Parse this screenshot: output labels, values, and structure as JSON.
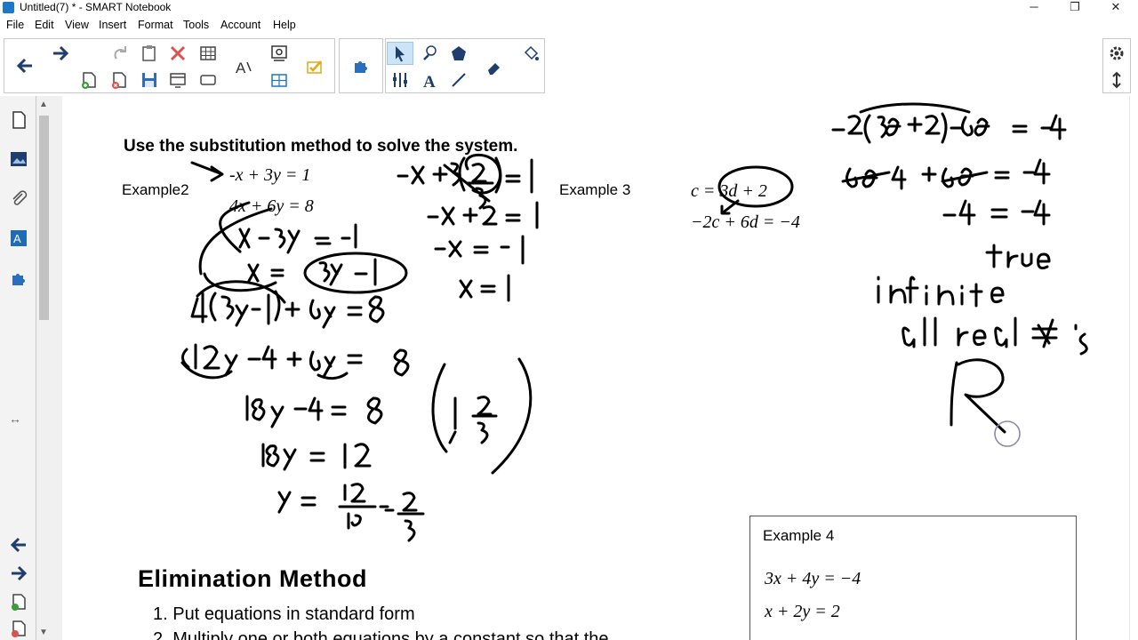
{
  "window": {
    "title": "Untitled(7) * - SMART Notebook",
    "minimize": "─",
    "restore": "❐",
    "close": "✕"
  },
  "menu": [
    "File",
    "Edit",
    "View",
    "Insert",
    "Format",
    "Tools",
    "Account",
    "Help"
  ],
  "icons": {
    "back": "arrow-left-icon",
    "forward": "arrow-right-icon",
    "redo": "redo-icon",
    "select": "select-arrow-icon",
    "settings": "gear-icon",
    "move": "move-toolbar-icon"
  },
  "colors": {
    "accent": "#1e77c8",
    "selected": "#cce4f7",
    "ink": "#000000"
  },
  "page": {
    "heading": "Use the substitution method to solve the system.",
    "example2_label": "Example2",
    "example3_label": "Example 3",
    "eq2_1": "-x + 3y = 1",
    "eq2_2": "4x + 6y = 8",
    "eq3_1": "c = 3d + 2",
    "eq3_2": "−2c + 6d = −4",
    "example4": {
      "label": "Example 4",
      "eq1": "3x +  4y =  −4",
      "eq2": "x +  2y =  2"
    },
    "elimination": {
      "title": "Elimination Method",
      "step1": "1. Put equations in standard form",
      "step2": "2. Multiply one or both equations by a constant so that the"
    }
  }
}
